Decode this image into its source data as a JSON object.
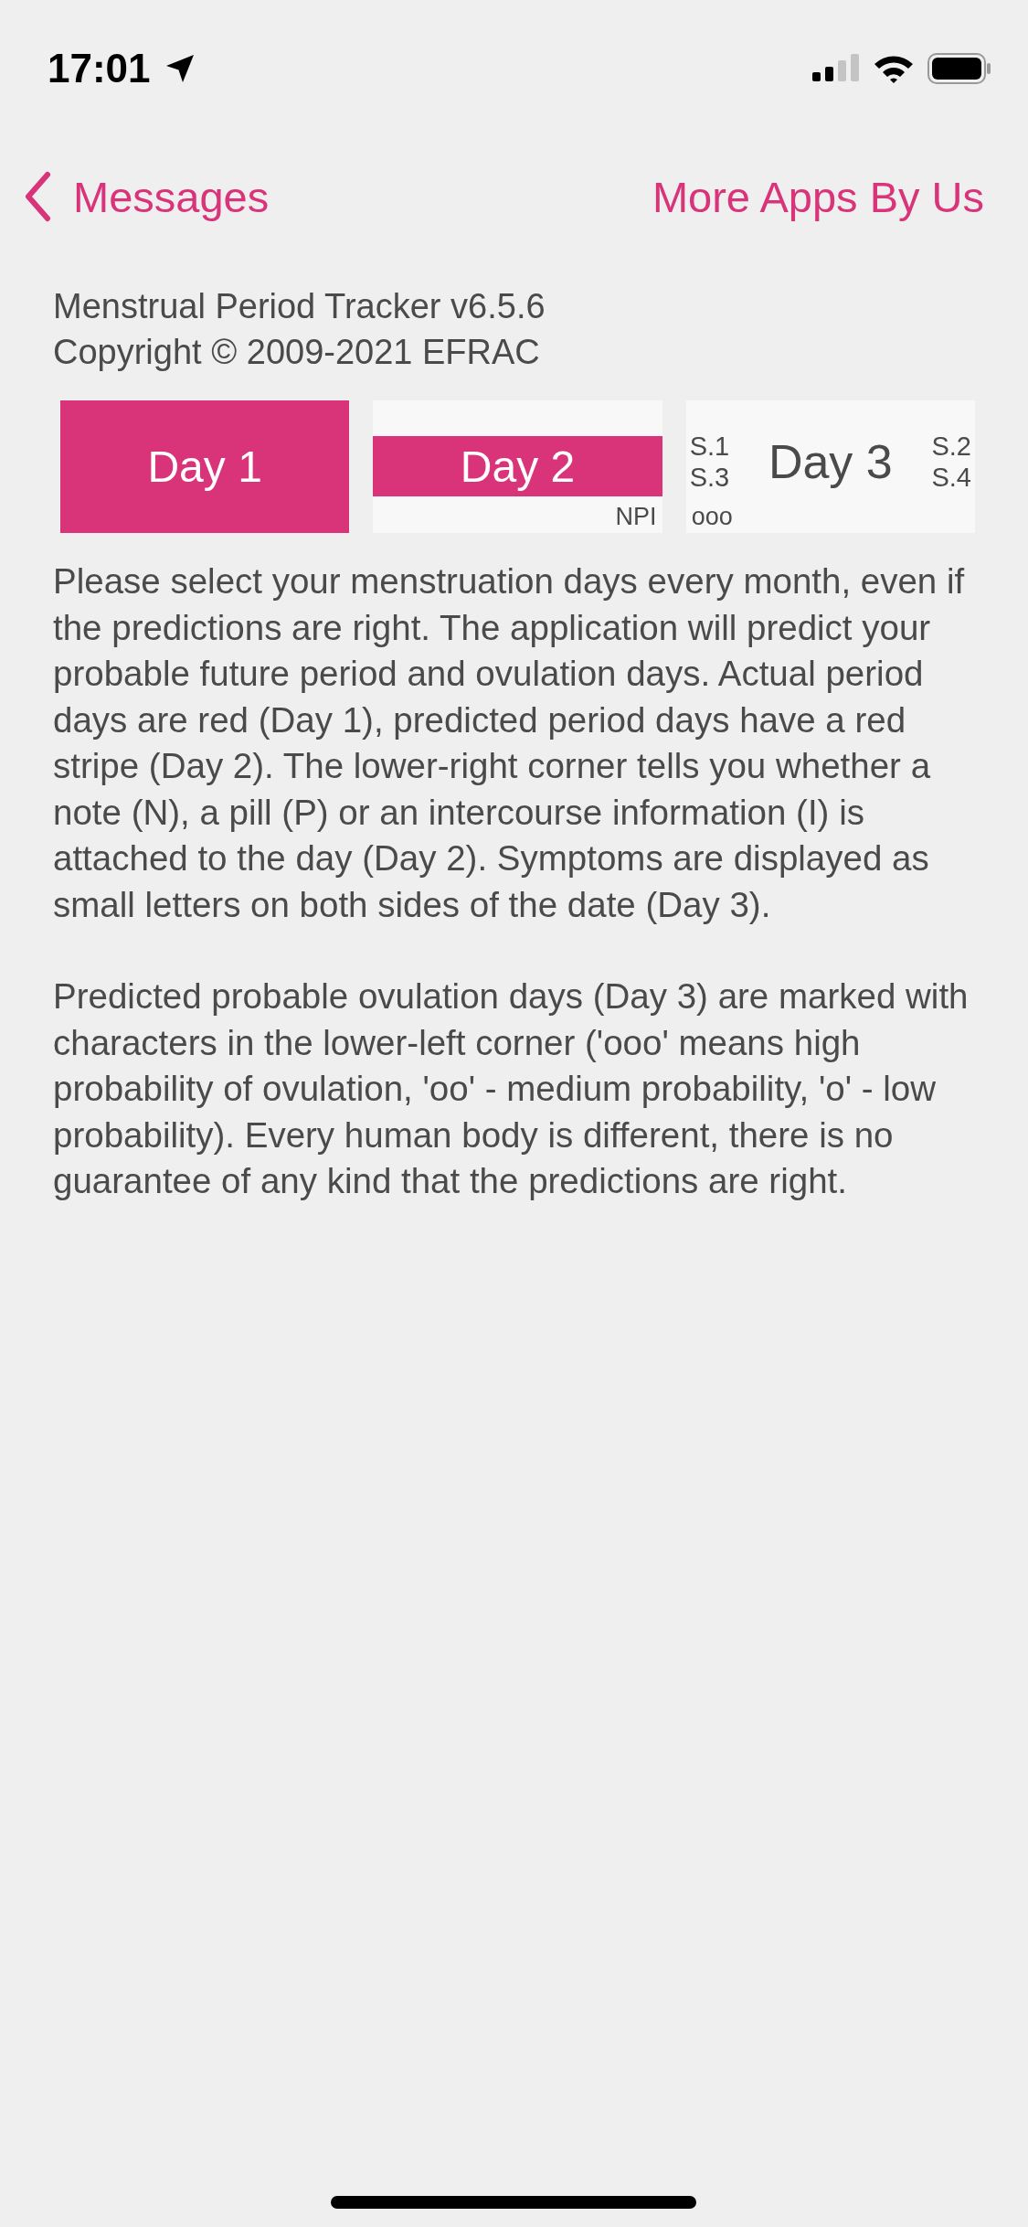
{
  "status_bar": {
    "time": "17:01"
  },
  "nav": {
    "back": "Messages",
    "action": "More Apps By Us"
  },
  "about": [
    "Menstrual Period Tracker v6.5.6",
    "Copyright © 2009-2021 EFRAC"
  ],
  "days": [
    {
      "kind": "actual",
      "label": "Day 1"
    },
    {
      "kind": "predicted",
      "label": "Day 2",
      "corner": "NPI"
    },
    {
      "kind": "symptoms",
      "label": "Day 3",
      "left": [
        "S.1",
        "S.3"
      ],
      "right": [
        "S.2",
        "S.4"
      ],
      "ovulation": "ooo"
    }
  ],
  "paragraphs": [
    "Please select your menstruation days every month, even if the predictions are right. The application will predict your probable future period and ovulation days. Actual period days are red (Day 1), predicted period days have a red stripe (Day 2). The lower-right corner tells you whether a note (N), a pill (P) or an intercourse information (I) is attached to the day (Day 2). Symptoms are displayed as small letters on both sides of the date (Day 3).",
    "Predicted probable ovulation days (Day 3) are marked with characters in the lower-left corner ('ooo' means high probability of ovulation, 'oo' - medium probability, 'o' - low probability). Every human body is different, there is no guarantee of any kind that the predictions are right."
  ]
}
